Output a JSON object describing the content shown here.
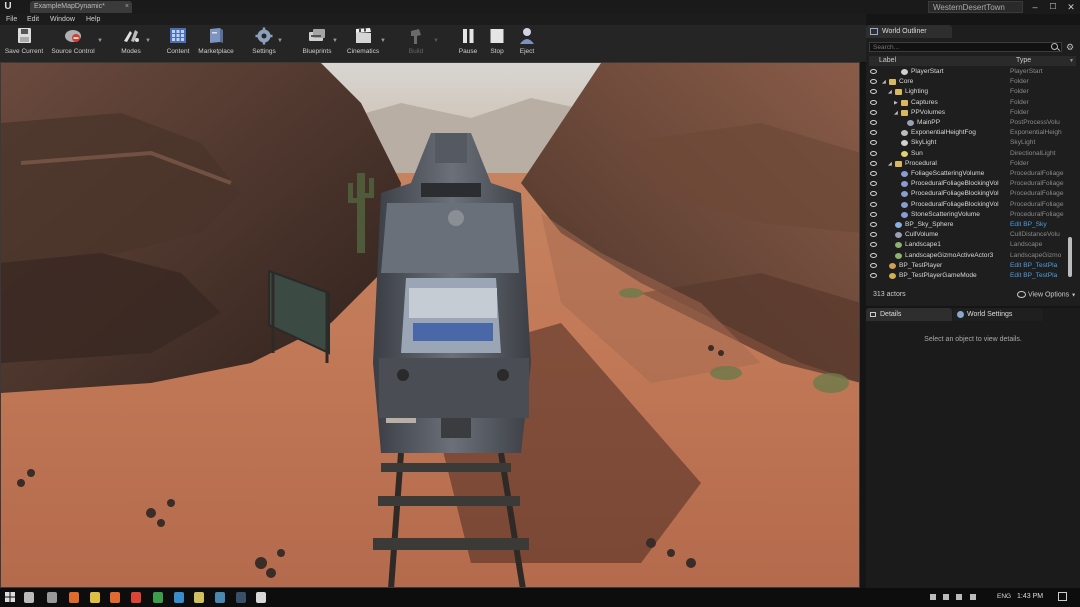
{
  "window": {
    "logo": "U",
    "doc_tab": "ExampleMapDynamic*",
    "tab_close": "×",
    "project": "WesternDesertTown",
    "controls": {
      "minimize": "–",
      "maximize": "☐",
      "close": "✕"
    }
  },
  "menu": [
    "File",
    "Edit",
    "Window",
    "Help"
  ],
  "toolbar": [
    {
      "label": "Save Current",
      "icon": "save-icon",
      "color": "#e0e0e0"
    },
    {
      "label": "Source Control",
      "icon": "source-control-icon",
      "color": "#c84a3a"
    },
    {
      "label": "Modes",
      "icon": "modes-icon",
      "color": "#e0e0e0"
    },
    {
      "label": "Content",
      "icon": "content-browser-icon",
      "color": "#6a8cc8"
    },
    {
      "label": "Marketplace",
      "icon": "marketplace-icon",
      "color": "#8aa0c8"
    },
    {
      "label": "Settings",
      "icon": "settings-gear-icon",
      "color": "#9ab0c8"
    },
    {
      "label": "Blueprints",
      "icon": "blueprints-icon",
      "color": "#c8c8c8"
    },
    {
      "label": "Cinematics",
      "icon": "clapperboard-icon",
      "color": "#d0d0d0"
    },
    {
      "label": "Build",
      "icon": "build-icon",
      "color": "#666666"
    },
    {
      "label": "Pause",
      "icon": "pause-icon",
      "color": "#e0e0e0"
    },
    {
      "label": "Stop",
      "icon": "stop-icon",
      "color": "#e0e0e0"
    },
    {
      "label": "Eject",
      "icon": "eject-icon",
      "color": "#c0c8e0"
    }
  ],
  "outliner": {
    "tab": "World Outliner",
    "search_placeholder": "Search...",
    "col_label": "Label",
    "col_type": "Type",
    "rows": [
      {
        "label": "PlayerStart",
        "type": "PlayerStart",
        "icon": "player-start-icon"
      },
      {
        "label": "Core",
        "type": "Folder",
        "icon": "folder-icon"
      },
      {
        "label": "Lighting",
        "type": "Folder",
        "icon": "folder-icon"
      },
      {
        "label": "Captures",
        "type": "Folder",
        "icon": "folder-icon"
      },
      {
        "label": "PPVolumes",
        "type": "Folder",
        "icon": "folder-icon"
      },
      {
        "label": "MainPP",
        "type": "PostProcessVolu",
        "icon": "volume-icon"
      },
      {
        "label": "ExponentialHeightFog",
        "type": "ExponentialHeigh",
        "icon": "fog-icon"
      },
      {
        "label": "SkyLight",
        "type": "SkyLight",
        "icon": "skylight-icon"
      },
      {
        "label": "Sun",
        "type": "DirectionalLight",
        "icon": "sun-icon"
      },
      {
        "label": "Procedural",
        "type": "Folder",
        "icon": "folder-icon"
      },
      {
        "label": "FoliageScatteringVolume",
        "type": "ProceduralFoliage",
        "icon": "procedural-volume-icon"
      },
      {
        "label": "ProceduralFoliageBlockingVol",
        "type": "ProceduralFoliage",
        "icon": "procedural-volume-icon"
      },
      {
        "label": "ProceduralFoliageBlockingVol",
        "type": "ProceduralFoliage",
        "icon": "procedural-volume-icon"
      },
      {
        "label": "ProceduralFoliageBlockingVol",
        "type": "ProceduralFoliage",
        "icon": "procedural-volume-icon"
      },
      {
        "label": "StoneScatteringVolume",
        "type": "ProceduralFoliage",
        "icon": "procedural-volume-icon"
      },
      {
        "label": "BP_Sky_Sphere",
        "type": "Edit BP_Sky",
        "icon": "sky-sphere-icon"
      },
      {
        "label": "CullVolume",
        "type": "CullDistanceVolu",
        "icon": "volume-icon"
      },
      {
        "label": "Landscape1",
        "type": "Landscape",
        "icon": "landscape-icon"
      },
      {
        "label": "LandscapeGizmoActiveActor3",
        "type": "LandscapeGizmo",
        "icon": "landscape-icon"
      },
      {
        "label": "BP_TestPlayer",
        "type": "Edit BP_TestPla",
        "icon": "pawn-icon"
      },
      {
        "label": "BP_TestPlayerGameMode",
        "type": "Edit BP_TestPla",
        "icon": "gamemode-icon"
      }
    ],
    "actor_count": "313 actors",
    "view_options": "View Options"
  },
  "details": {
    "tab": "Details",
    "world_settings_tab": "World Settings",
    "hint": "Select an object to view details."
  },
  "taskbar": {
    "language": "ENG",
    "time": "1:43 PM",
    "apps": [
      "windows-start-icon",
      "search-icon",
      "task-view-icon",
      "unreal-icon",
      "file-explorer-icon",
      "firefox-icon",
      "chrome-icon",
      "whatsapp-icon",
      "telegram-icon",
      "app-icon",
      "app-icon",
      "steam-icon",
      "folder-icon",
      "app-icon",
      "unreal-engine-icon"
    ]
  }
}
